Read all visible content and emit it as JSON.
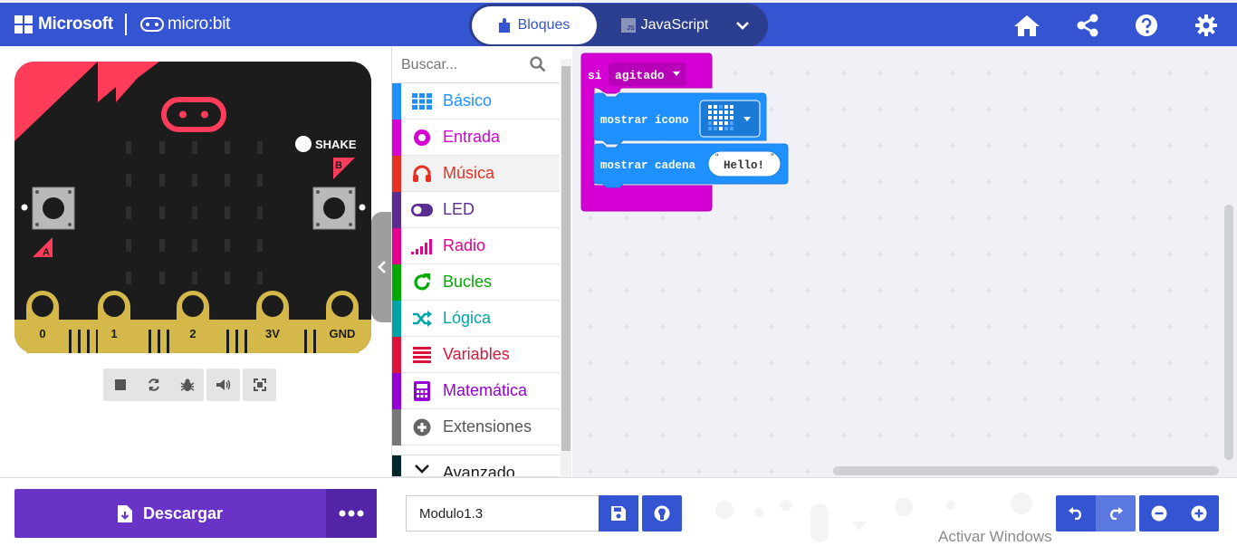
{
  "header": {
    "microsoft_label": "Microsoft",
    "microbit_label": "micro:bit",
    "tab_blocks": "Bloques",
    "tab_js": "JavaScript",
    "js_badge": "JS",
    "icons": [
      "home-icon",
      "share-icon",
      "help-icon",
      "settings-icon"
    ]
  },
  "simulator": {
    "shake_label": "SHAKE",
    "button_a": "A",
    "button_b": "B",
    "pins": [
      "0",
      "1",
      "2",
      "3V",
      "GND"
    ]
  },
  "toolbox": {
    "search_placeholder": "Buscar...",
    "categories": [
      {
        "label": "Básico",
        "color": "#1e90ff"
      },
      {
        "label": "Entrada",
        "color": "#d400d4"
      },
      {
        "label": "Música",
        "color": "#e63022"
      },
      {
        "label": "LED",
        "color": "#5c2d91"
      },
      {
        "label": "Radio",
        "color": "#e3008c"
      },
      {
        "label": "Bucles",
        "color": "#00aa00"
      },
      {
        "label": "Lógica",
        "color": "#00a4a6"
      },
      {
        "label": "Variables",
        "color": "#dc143c"
      },
      {
        "label": "Matemática",
        "color": "#9400d3"
      },
      {
        "label": "Extensiones",
        "color": "#777777"
      },
      {
        "label": "Avanzado",
        "color": "#00272b"
      }
    ]
  },
  "workspace": {
    "event_keyword": "si",
    "event_option": "agitado",
    "show_icon_label": "mostrar ícono",
    "show_string_label": "mostrar cadena",
    "string_value": "Hello!",
    "event_color": "#d400d4",
    "basic_color": "#1e90ff"
  },
  "bottom": {
    "download_label": "Descargar",
    "project_name": "Modulo1.3",
    "watermark": "Activar Windows"
  }
}
